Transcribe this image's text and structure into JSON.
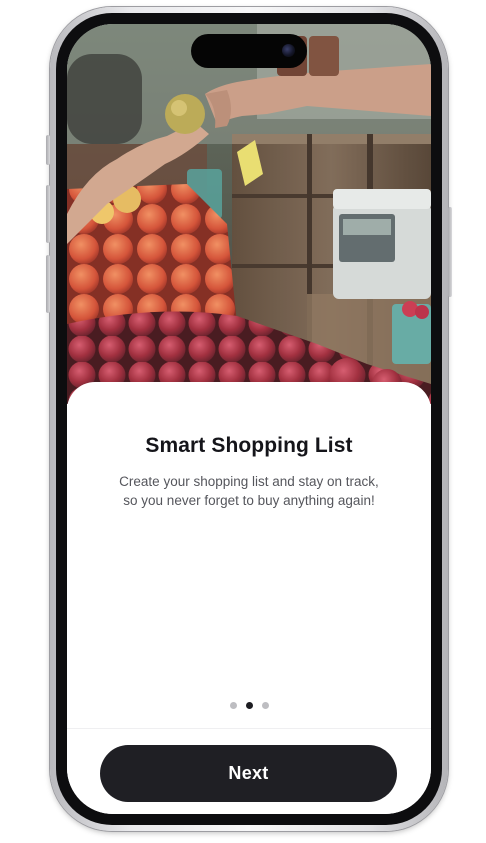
{
  "onboarding": {
    "title": "Smart Shopping List",
    "description": "Create your shopping list and stay on track, so you never forget to buy anything again!",
    "next_label": "Next",
    "page_indicator": {
      "pages": 3,
      "current_index": 2
    }
  },
  "colors": {
    "button_bg": "#1f1f24",
    "title_text": "#15151a",
    "body_text": "#55565c",
    "dot_active": "#1d1d22",
    "dot_inactive": "#bdbdc1"
  }
}
